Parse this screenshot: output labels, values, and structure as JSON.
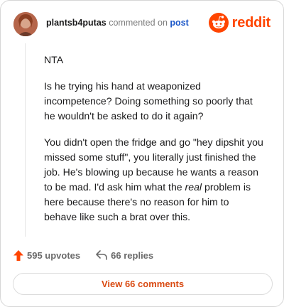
{
  "header": {
    "username": "plantsb4putas",
    "verb": "commented on",
    "post_link": "post",
    "logo_text": "reddit",
    "avatar_icon": "user-avatar",
    "logo_icon": "reddit-snoo-icon",
    "brand_color": "#ff4500"
  },
  "comment": {
    "p1": "NTA",
    "p2": "Is he trying his hand at weaponized incompetence? Doing something so poorly that he wouldn't be asked to do it again?",
    "p3": "You didn't open the fridge and go \"hey dipshit you missed some stuff\", you literally just finished the job. He's blowing up because he wants a reason to be mad. I'd ask him what the",
    "p3_em": "real",
    "p3_end": "problem is here because there's no reason for him to behave like such a brat over this."
  },
  "actions": {
    "upvotes": "595 upvotes",
    "upvote_icon": "upvote-arrow-icon",
    "replies": "66 replies",
    "reply_icon": "reply-arrow-icon"
  },
  "footer": {
    "view_label": "View 66 comments"
  }
}
